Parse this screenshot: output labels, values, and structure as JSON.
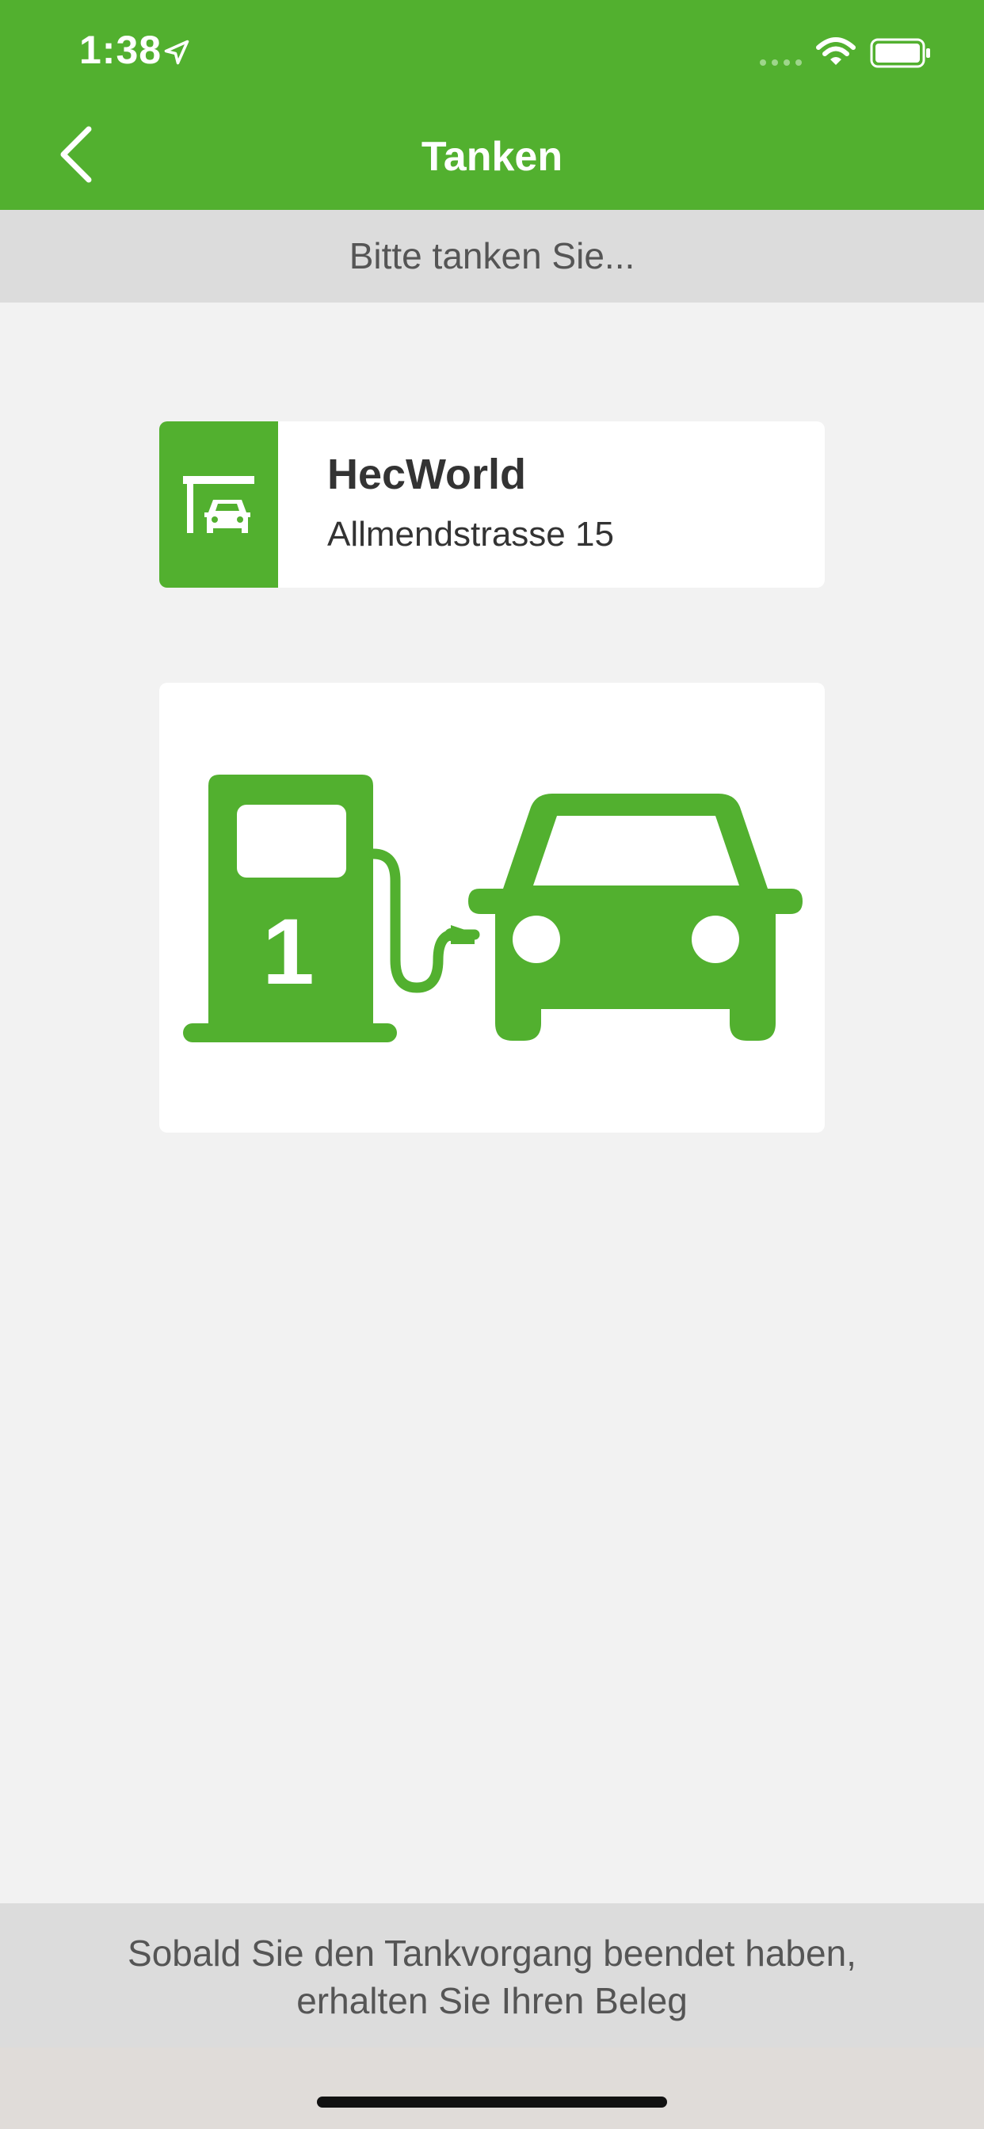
{
  "status_bar": {
    "time": "1:38"
  },
  "nav": {
    "title": "Tanken"
  },
  "banner": {
    "text": "Bitte tanken Sie..."
  },
  "station": {
    "name": "HecWorld",
    "address": "Allmendstrasse 15",
    "icon": "gas-station-icon"
  },
  "pump": {
    "number": "1",
    "icon": "fuel-pump-car-icon"
  },
  "footer": {
    "line1": "Sobald Sie den Tankvorgang beendet haben,",
    "line2": "erhalten Sie Ihren Beleg"
  },
  "colors": {
    "primary_green": "#52b02f",
    "banner_gray": "#dcdcdc",
    "background": "#f2f2f2"
  }
}
